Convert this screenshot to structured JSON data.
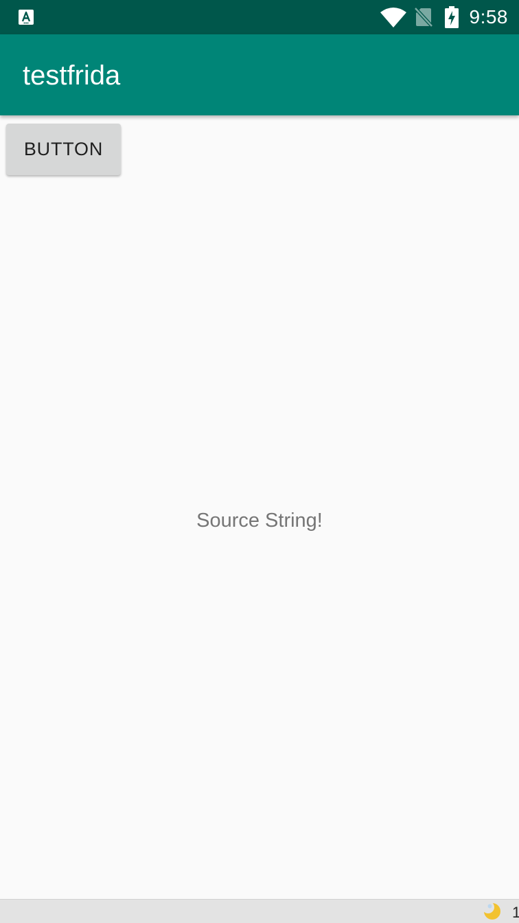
{
  "status_bar": {
    "left_icon": "accessibility-icon",
    "icons": [
      "wifi-icon",
      "no-sim-icon",
      "battery-charging-icon"
    ],
    "time": "9:58",
    "background_color": "#00574b"
  },
  "app_bar": {
    "title": "testfrida",
    "background_color": "#008577"
  },
  "main": {
    "button_label": "BUTTON",
    "center_text": "Source String!"
  },
  "bottom_bar": {
    "icon": "moon-icon",
    "text": "1"
  }
}
